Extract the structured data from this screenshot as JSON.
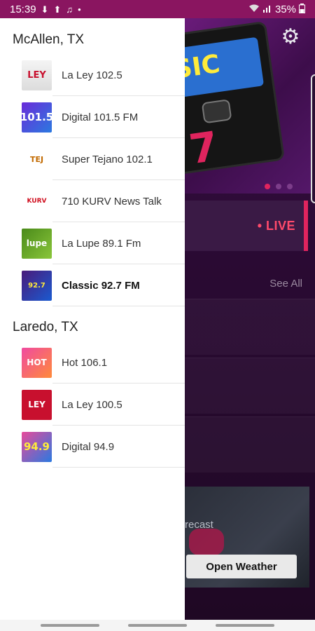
{
  "status_bar": {
    "time": "15:39",
    "battery": "35%",
    "notification_icons": [
      "download-icon",
      "upload-icon",
      "music-note-icon",
      "dot-icon"
    ]
  },
  "background": {
    "live_label": "• LIVE",
    "see_all": "See All",
    "weather_text": "recast",
    "open_weather": "Open Weather",
    "hero_label": "SIC",
    "hero_number": "7"
  },
  "drawer": {
    "groups": [
      {
        "city": "McAllen, TX",
        "stations": [
          {
            "name": "La Ley 102.5",
            "logo_text": "LEY"
          },
          {
            "name": "Digital 101.5 FM",
            "logo_text": "101.5"
          },
          {
            "name": "Super Tejano 102.1",
            "logo_text": "TEJ"
          },
          {
            "name": "710 KURV News Talk",
            "logo_text": "KURV"
          },
          {
            "name": "La Lupe 89.1 Fm",
            "logo_text": "lupe"
          },
          {
            "name": "Classic 92.7 FM",
            "logo_text": "92.7"
          }
        ]
      },
      {
        "city": "Laredo, TX",
        "stations": [
          {
            "name": "Hot 106.1",
            "logo_text": "HOT"
          },
          {
            "name": "La Ley 100.5",
            "logo_text": "LEY"
          },
          {
            "name": "Digital 94.9",
            "logo_text": "94.9"
          }
        ]
      }
    ]
  },
  "colors": {
    "status_bar": "#8a1560",
    "accent": "#e0245e",
    "drawer_bg": "#ffffff"
  }
}
